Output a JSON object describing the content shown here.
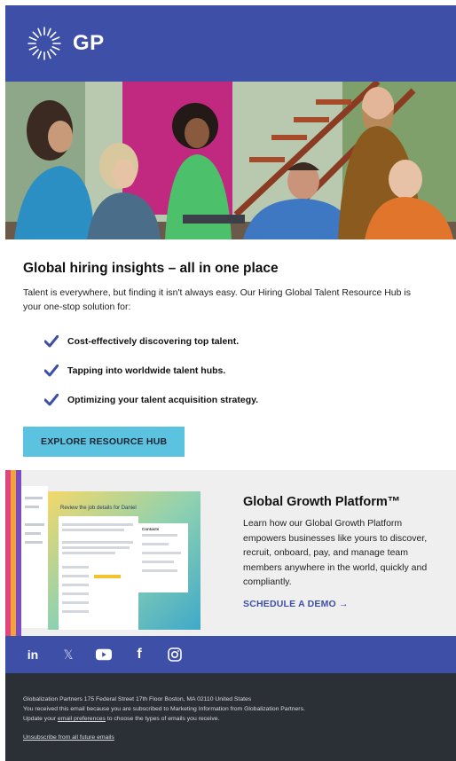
{
  "header": {
    "logo_text": "GP",
    "logo_icon": "sunburst-icon",
    "bg_color": "#3d4fa6"
  },
  "hero": {
    "image_icon": "group-photo"
  },
  "main": {
    "headline": "Global hiring insights – all in one place",
    "intro": "Talent is everywhere, but finding it isn't always easy. Our Hiring Global Talent Resource Hub is your one-stop solution for:",
    "benefits": [
      "Cost-effectively discovering top talent.",
      "Tapping into worldwide talent hubs.",
      "Optimizing your talent acquisition strategy."
    ],
    "check_color": "#3d4fa6",
    "cta_label": "EXPLORE RESOURCE HUB",
    "cta_color": "#5bc3e0"
  },
  "platform": {
    "title": "Global Growth Platform™",
    "description": "Learn how our Global Growth Platform empowers businesses like yours to discover, recruit, onboard, pay, and manage team members anywhere in the world, quickly and compliantly.",
    "link_label": "SCHEDULE A DEMO →",
    "art": {
      "screen_title": "Review the job details for Daniel",
      "card_heading": "Contacts"
    }
  },
  "social": {
    "icons": [
      "linkedin-icon",
      "x-icon",
      "youtube-icon",
      "facebook-icon",
      "instagram-icon"
    ],
    "labels": [
      "in",
      "𝕏",
      "▶",
      "f",
      "◎"
    ]
  },
  "footer": {
    "address": "Globalization Partners 175 Federal Street 17th Floor Boston, MA 02110 United States",
    "reason": "You received this email because you are subscribed to Marketing Information from Globalization Partners.",
    "update_prefix": "Update your ",
    "update_link": "email preferences",
    "update_suffix": " to choose the types of emails you receive.",
    "unsubscribe": "Unsubscribe from all future emails"
  }
}
